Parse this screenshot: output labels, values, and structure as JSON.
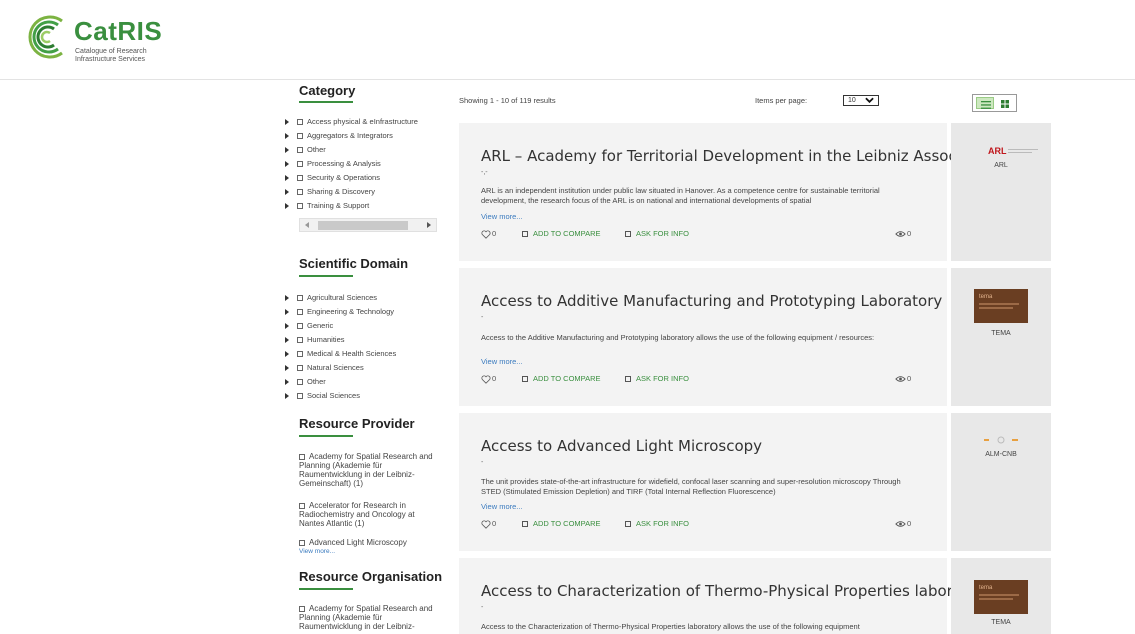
{
  "header": {
    "logo_title": "CatRIS",
    "logo_subtitle_1": "Catalogue of Research",
    "logo_subtitle_2": "Infrastructure Services",
    "brand_color": "#3a8f3f"
  },
  "sidebar": {
    "category": {
      "title": "Category",
      "items": [
        "Access physical & eInfrastructure",
        "Aggregators & Integrators",
        "Other",
        "Processing & Analysis",
        "Security & Operations",
        "Sharing & Discovery",
        "Training & Support"
      ]
    },
    "scientific_domain": {
      "title": "Scientific Domain",
      "items": [
        "Agricultural Sciences",
        "Engineering & Technology",
        "Generic",
        "Humanities",
        "Medical & Health Sciences",
        "Natural Sciences",
        "Other",
        "Social Sciences"
      ]
    },
    "resource_provider": {
      "title": "Resource Provider",
      "items": [
        "Academy for Spatial Research and Planning (Akademie für Raumentwicklung in der Leibniz-Gemeinschaft) (1)",
        "Accelerator for Research in Radiochemistry and Oncology at Nantes Atlantic (1)",
        "Advanced Light Microscopy"
      ],
      "view_more": "View more..."
    },
    "resource_organisation": {
      "title": "Resource Organisation",
      "items": [
        "Academy for Spatial Research and Planning (Akademie für Raumentwicklung in der Leibniz-"
      ]
    }
  },
  "results_bar": {
    "showing": "Showing 1 - 10 of 119 results",
    "items_per_page_label": "Items per page:",
    "items_per_page_value": "10"
  },
  "results": [
    {
      "title": "ARL – Academy for Territorial Development in the Leibniz Association",
      "subtitle": "-,-",
      "description": "ARL is an independent institution under public law situated in Hanover. As a competence centre for sustainable territorial development, the research focus of the ARL is on national and international developments of spatial",
      "view_more": "View more...",
      "likes": "0",
      "compare_label": "ADD TO COMPARE",
      "ask_label": "ASK FOR INFO",
      "views": "0",
      "provider": "ARL",
      "logo_text": "ARL"
    },
    {
      "title": "Access to Additive Manufacturing and Prototyping Laboratory",
      "subtitle": "-",
      "description": "Access to the Additive Manufacturing and Prototyping laboratory allows the use of the following equipment / resources:",
      "view_more": "View more...",
      "likes": "0",
      "compare_label": "ADD TO COMPARE",
      "ask_label": "ASK FOR INFO",
      "views": "0",
      "provider": "TEMA",
      "logo_text": "tema"
    },
    {
      "title": "Access to Advanced Light Microscopy",
      "subtitle": "-",
      "description": "The unit provides state-of-the-art infrastructure for widefield, confocal laser scanning and super-resolution microscopy Through STED (Stimulated Emission Depletion) and TIRF (Total Internal Reflection Fluorescence)",
      "view_more": "View more...",
      "likes": "0",
      "compare_label": "ADD TO COMPARE",
      "ask_label": "ASK FOR INFO",
      "views": "0",
      "provider": "ALM-CNB",
      "logo_text": ""
    },
    {
      "title": "Access to Characterization of Thermo-Physical Properties laboratory",
      "subtitle": "-",
      "description": "Access to the Characterization of Thermo-Physical Properties laboratory allows the use of the following equipment",
      "provider": "TEMA",
      "logo_text": "tema"
    }
  ]
}
